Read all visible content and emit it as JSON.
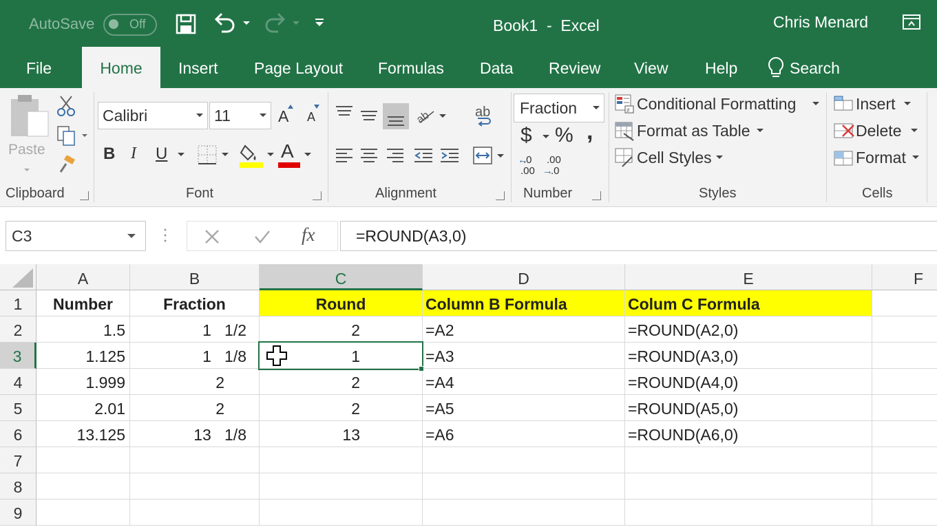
{
  "titlebar": {
    "autosave_label": "AutoSave",
    "autosave_state": "Off",
    "doc_title": "Book1  -  Excel",
    "user": "Chris Menard"
  },
  "tabs": [
    {
      "label": "File"
    },
    {
      "label": "Home"
    },
    {
      "label": "Insert"
    },
    {
      "label": "Page Layout"
    },
    {
      "label": "Formulas"
    },
    {
      "label": "Data"
    },
    {
      "label": "Review"
    },
    {
      "label": "View"
    },
    {
      "label": "Help"
    },
    {
      "label": "Search"
    }
  ],
  "ribbon": {
    "clipboard": {
      "paste": "Paste",
      "label": "Clipboard"
    },
    "font": {
      "name": "Calibri",
      "size": "11",
      "label": "Font",
      "bold": "B",
      "italic": "I",
      "underline": "U",
      "grow": "A",
      "shrink": "A",
      "color_glyph": "A"
    },
    "alignment": {
      "label": "Alignment",
      "orient": "ab"
    },
    "number": {
      "format": "Fraction",
      "label": "Number",
      "currency": "$",
      "percent": "%",
      "comma": ",",
      "inc": ".00",
      "dec": ".0"
    },
    "styles": {
      "conditional": "Conditional Formatting",
      "table": "Format as Table",
      "cell_styles": "Cell Styles",
      "label": "Styles"
    },
    "cells": {
      "insert": "Insert",
      "delete": "Delete",
      "format": "Format",
      "label": "Cells"
    },
    "colors": {
      "highlight": "#ffff00",
      "font_color": "#e00000"
    }
  },
  "formula_bar": {
    "name_box": "C3",
    "fx": "fx",
    "formula": "=ROUND(A3,0)"
  },
  "sheet": {
    "columns": [
      "A",
      "B",
      "C",
      "D",
      "E",
      "F"
    ],
    "rows": [
      "1",
      "2",
      "3",
      "4",
      "5",
      "6",
      "7",
      "8",
      "9"
    ],
    "data": [
      [
        "Number",
        "Fraction",
        "Round",
        "Column B Formula",
        "Colum C Formula"
      ],
      [
        "1.5",
        "1   1/2",
        "2",
        "=A2",
        "=ROUND(A2,0)"
      ],
      [
        "1.125",
        "1   1/8",
        "1",
        "=A3",
        "=ROUND(A3,0)"
      ],
      [
        "1.999",
        "2     ",
        "2",
        "=A4",
        "=ROUND(A4,0)"
      ],
      [
        "2.01",
        "2     ",
        "2",
        "=A5",
        "=ROUND(A5,0)"
      ],
      [
        "13.125",
        "13   1/8",
        "13",
        "=A6",
        "=ROUND(A6,0)"
      ]
    ],
    "selected_cell": "C3",
    "header_fill": "#ffff00"
  }
}
